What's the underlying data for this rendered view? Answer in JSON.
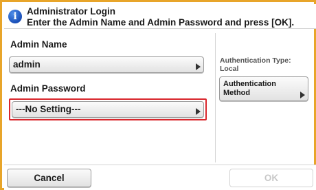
{
  "header": {
    "title": "Administrator Login",
    "message": "Enter the Admin Name and Admin Password and press [OK].",
    "icon": "info-icon",
    "icon_glyph": "i"
  },
  "admin_name": {
    "label": "Admin Name",
    "value": "admin"
  },
  "admin_password": {
    "label": "Admin Password",
    "value": "---No Setting---"
  },
  "auth": {
    "type_label": "Authentication Type:",
    "type_value": "Local",
    "button_line1": "Authentication",
    "button_line2": "Method"
  },
  "footer": {
    "cancel_label": "Cancel",
    "ok_label": "OK"
  },
  "colors": {
    "frame": "#e8a52a",
    "highlight": "#d9262c",
    "disabled_text": "#c8c8c8"
  }
}
